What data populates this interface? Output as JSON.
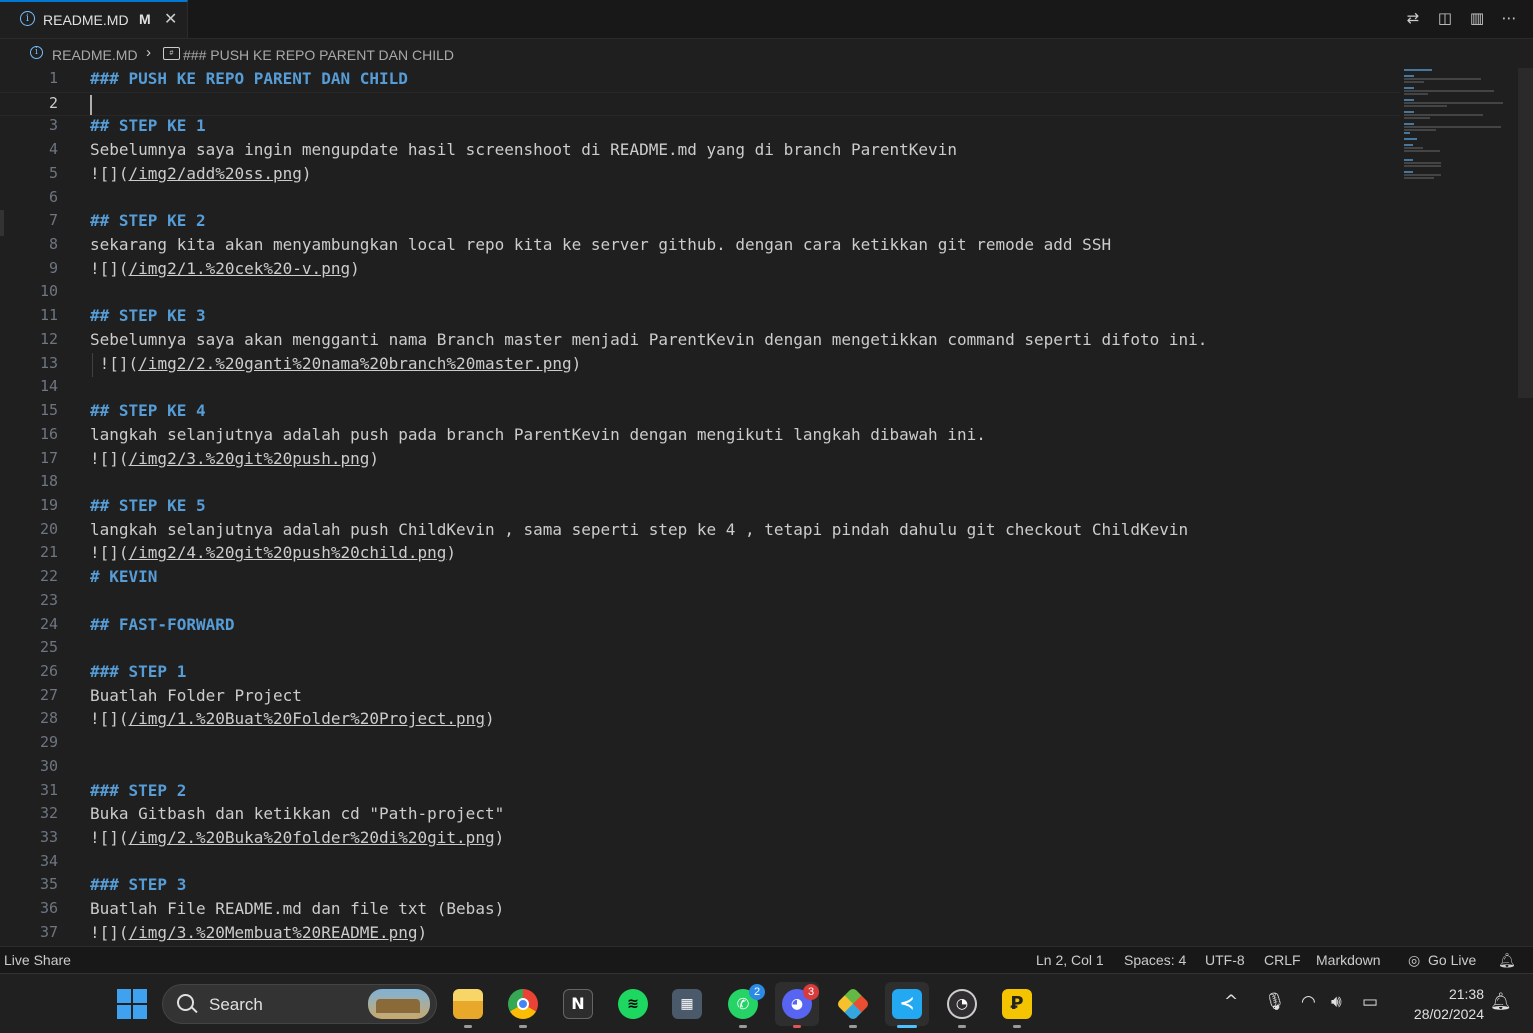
{
  "tab": {
    "title": "README.MD",
    "modified": "M"
  },
  "breadcrumb": {
    "file": "README.MD",
    "symbol": "### PUSH KE REPO PARENT DAN CHILD"
  },
  "editor": {
    "lines": [
      {
        "n": "1",
        "text": "### PUSH KE REPO PARENT DAN CHILD",
        "heading": true
      },
      {
        "n": "2",
        "text": "",
        "current": true
      },
      {
        "n": "3",
        "text": "## STEP KE 1",
        "heading": true
      },
      {
        "n": "4",
        "text": "Sebelumnya saya ingin mengupdate hasil screenshoot di README.md yang di branch ParentKevin"
      },
      {
        "n": "5",
        "pre": "![](",
        "link": "/img2/add%20ss.png",
        "post": ")"
      },
      {
        "n": "6",
        "text": ""
      },
      {
        "n": "7",
        "text": "## STEP KE 2",
        "heading": true
      },
      {
        "n": "8",
        "text": "sekarang kita akan menyambungkan local repo kita ke server github. dengan cara ketikkan git remode add SSH"
      },
      {
        "n": "9",
        "pre": "![](",
        "link": "/img2/1.%20cek%20-v.png",
        "post": ")"
      },
      {
        "n": "10",
        "text": ""
      },
      {
        "n": "11",
        "text": "## STEP KE 3",
        "heading": true
      },
      {
        "n": "12",
        "text": "Sebelumnya saya akan mengganti nama Branch master menjadi ParentKevin dengan mengetikkan command seperti difoto ini."
      },
      {
        "n": "13",
        "pre": " ![](",
        "link": "/img2/2.%20ganti%20nama%20branch%20master.png",
        "post": ")",
        "indented": true
      },
      {
        "n": "14",
        "text": ""
      },
      {
        "n": "15",
        "text": "## STEP KE 4",
        "heading": true
      },
      {
        "n": "16",
        "text": "langkah selanjutnya adalah push pada branch ParentKevin dengan mengikuti langkah dibawah ini."
      },
      {
        "n": "17",
        "pre": "![](",
        "link": "/img2/3.%20git%20push.png",
        "post": ")"
      },
      {
        "n": "18",
        "text": ""
      },
      {
        "n": "19",
        "text": "## STEP KE 5",
        "heading": true
      },
      {
        "n": "20",
        "text": "langkah selanjutnya adalah push ChildKevin , sama seperti step ke 4 , tetapi pindah dahulu git checkout ChildKevin"
      },
      {
        "n": "21",
        "pre": "![](",
        "link": "/img2/4.%20git%20push%20child.png",
        "post": ")"
      },
      {
        "n": "22",
        "text": "# KEVIN",
        "heading": true
      },
      {
        "n": "23",
        "text": ""
      },
      {
        "n": "24",
        "text": "## FAST-FORWARD",
        "heading": true
      },
      {
        "n": "25",
        "text": ""
      },
      {
        "n": "26",
        "text": "### STEP 1",
        "heading": true
      },
      {
        "n": "27",
        "text": "Buatlah Folder Project"
      },
      {
        "n": "28",
        "pre": "![](",
        "link": "/img/1.%20Buat%20Folder%20Project.png",
        "post": ")"
      },
      {
        "n": "29",
        "text": ""
      },
      {
        "n": "30",
        "text": ""
      },
      {
        "n": "31",
        "text": "### STEP 2",
        "heading": true
      },
      {
        "n": "32",
        "text": "Buka Gitbash dan ketikkan cd \"Path-project\""
      },
      {
        "n": "33",
        "pre": "![](",
        "link": "/img/2.%20Buka%20folder%20di%20git.png",
        "post": ")"
      },
      {
        "n": "34",
        "text": ""
      },
      {
        "n": "35",
        "text": "### STEP 3",
        "heading": true
      },
      {
        "n": "36",
        "text": "Buatlah File README.md dan file txt (Bebas)"
      },
      {
        "n": "37",
        "pre": "![](",
        "link": "/img/3.%20Membuat%20README.png",
        "post": ")"
      }
    ]
  },
  "statusbar": {
    "live_share": "Live Share",
    "position": "Ln 2, Col 1",
    "spaces": "Spaces: 4",
    "encoding": "UTF-8",
    "eol": "CRLF",
    "language": "Markdown",
    "go_live": "Go Live"
  },
  "taskbar": {
    "search_label": "Search",
    "time": "21:38",
    "date": "28/02/2024",
    "whatsapp_badge": "2",
    "discord_badge": "3",
    "apps": [
      "file-explorer-icon",
      "chrome-icon",
      "notion-icon",
      "spotify-icon",
      "calculator-icon",
      "whatsapp-icon",
      "discord-icon",
      "git-icon",
      "vscode-icon",
      "obs-icon",
      "lightshot-icon"
    ]
  },
  "colors": {
    "accent": "#0078d4",
    "heading": "#569cd6",
    "background": "#1f1f1f",
    "taskbar": "#202020"
  }
}
